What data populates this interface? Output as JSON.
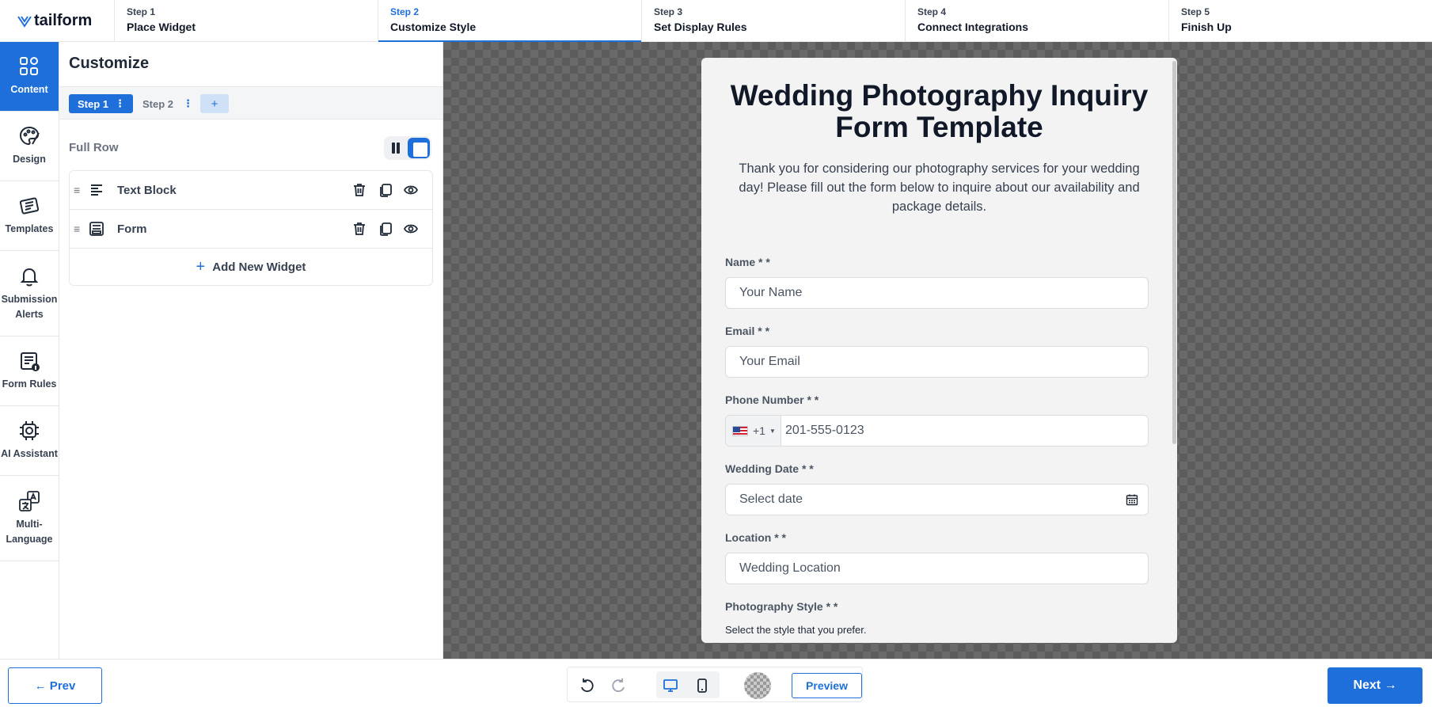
{
  "app": {
    "logo_text": "tailform"
  },
  "steps": [
    {
      "num": "Step 1",
      "label": "Place Widget"
    },
    {
      "num": "Step 2",
      "label": "Customize Style"
    },
    {
      "num": "Step 3",
      "label": "Set Display Rules"
    },
    {
      "num": "Step 4",
      "label": "Connect Integrations"
    },
    {
      "num": "Step 5",
      "label": "Finish Up"
    }
  ],
  "active_step": 1,
  "rail": [
    {
      "icon": "grid-icon",
      "label": "Content"
    },
    {
      "icon": "palette-icon",
      "label": "Design"
    },
    {
      "icon": "templates-icon",
      "label": "Templates"
    },
    {
      "icon": "bell-icon",
      "label": "Submission Alerts"
    },
    {
      "icon": "form-rules-icon",
      "label": "Form Rules"
    },
    {
      "icon": "ai-chip-icon",
      "label": "AI Assistant"
    },
    {
      "icon": "translate-icon",
      "label": "Multi-Language"
    }
  ],
  "panel": {
    "title": "Customize",
    "page_tabs": [
      {
        "label": "Step 1"
      },
      {
        "label": "Step 2"
      }
    ],
    "tab_dots": "⋮",
    "add_tab": "+",
    "row_label": "Full Row",
    "widgets": [
      {
        "icon": "text-align-left-icon",
        "name": "Text Block"
      },
      {
        "icon": "form-icon",
        "name": "Form"
      }
    ],
    "add_widget": "Add New Widget"
  },
  "form": {
    "title": "Wedding Photography Inquiry Form Template",
    "description": "Thank you for considering our photography services for your wedding day! Please fill out the form below to inquire about our availability and package details.",
    "fields": {
      "name": {
        "label": "Name * *",
        "placeholder": "Your Name"
      },
      "email": {
        "label": "Email * *",
        "placeholder": "Your Email"
      },
      "phone": {
        "label": "Phone Number * *",
        "country_code": "+1",
        "placeholder": "201-555-0123"
      },
      "date": {
        "label": "Wedding Date * *",
        "placeholder": "Select date"
      },
      "location": {
        "label": "Location * *",
        "placeholder": "Wedding Location"
      },
      "style": {
        "label": "Photography Style * *",
        "hint": "Select the style that you prefer."
      }
    }
  },
  "bottom": {
    "prev": "← Prev",
    "next": "Next →",
    "preview": "Preview"
  },
  "colors": {
    "accent": "#1e6fd9"
  }
}
